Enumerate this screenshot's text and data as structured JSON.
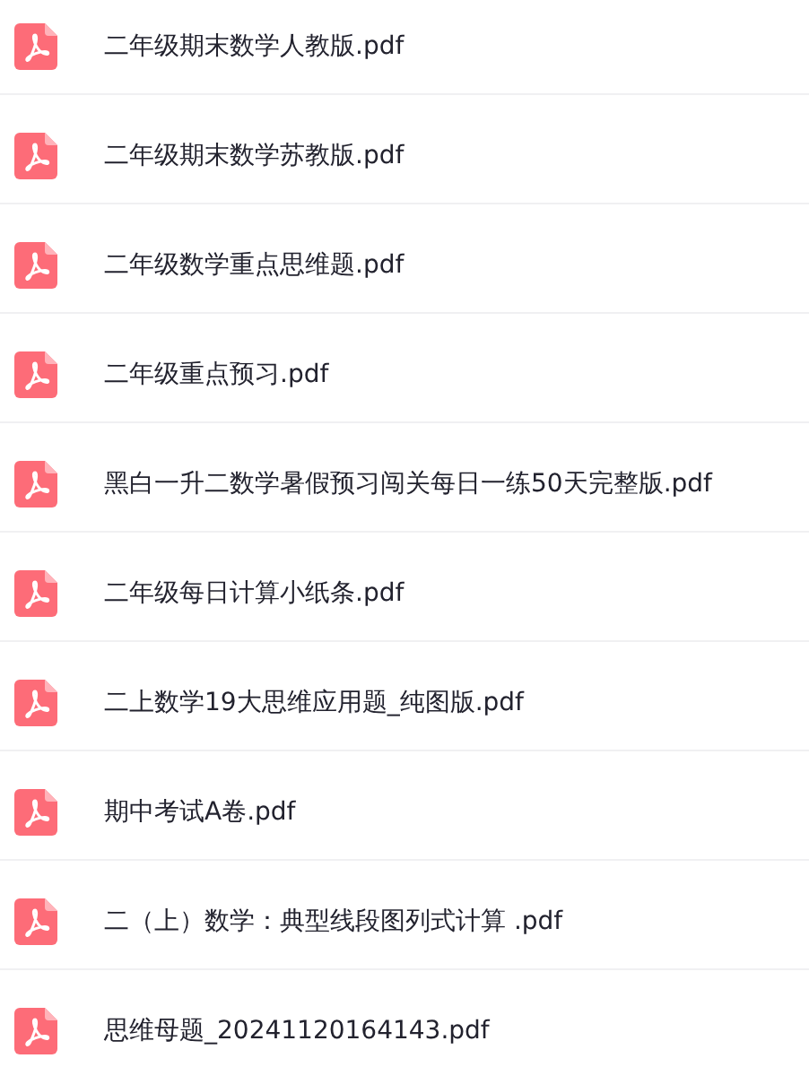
{
  "files": [
    {
      "name": "二年级期末数学人教版.pdf"
    },
    {
      "name": "二年级期末数学苏教版.pdf"
    },
    {
      "name": "二年级数学重点思维题.pdf"
    },
    {
      "name": "二年级重点预习.pdf"
    },
    {
      "name": "黑白一升二数学暑假预习闯关每日一练50天完整版.pdf"
    },
    {
      "name": "二年级每日计算小纸条.pdf"
    },
    {
      "name": "二上数学19大思维应用题_纯图版.pdf"
    },
    {
      "name": "期中考试A卷.pdf"
    },
    {
      "name": "二（上）数学：典型线段图列式计算 .pdf"
    },
    {
      "name": "思维母题_20241120164143.pdf"
    }
  ]
}
